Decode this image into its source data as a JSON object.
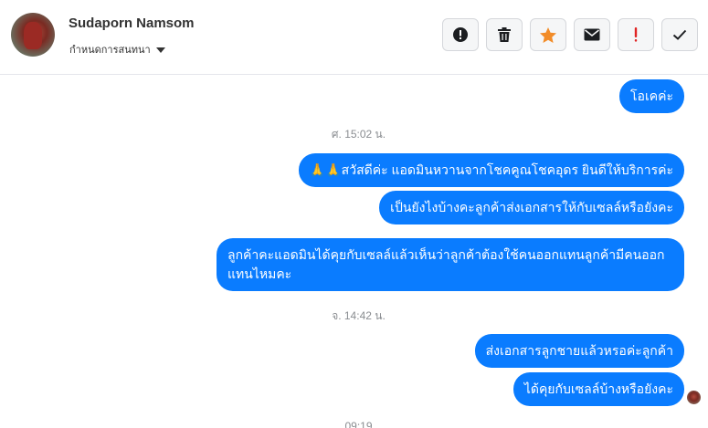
{
  "contact": {
    "name": "Sudaporn Namsom",
    "subtitle": "กำหนดการสนทนา"
  },
  "actions": [
    {
      "icon": "alert-circle-icon"
    },
    {
      "icon": "trash-icon"
    },
    {
      "icon": "star-icon",
      "color": "#f28c28"
    },
    {
      "icon": "envelope-icon"
    },
    {
      "icon": "exclamation-icon",
      "color": "#e02424"
    },
    {
      "icon": "check-icon"
    }
  ],
  "messages": {
    "m0": "โอเคค่ะ",
    "ts1": "ศ. 15:02 น.",
    "m1": "🙏🙏สวัสดีค่ะ แอดมินหวานจากโชคคูณโชคอุดร ยินดีให้บริการค่ะ",
    "m2": "เป็นยังไงบ้างคะลูกค้าส่งเอกสารให้กับเซลล์หรือยังคะ",
    "m3": "ลูกค้าคะแอดมินได้คุยกับเซลล์แล้วเห็นว่าลูกค้าต้องใช้คนออกแทนลูกค้ามีคนออกแทนไหมคะ",
    "ts2": "จ. 14:42 น.",
    "m4": "ส่งเอกสารลูกชายแล้วหรอค่ะลูกค้า",
    "m5": "ได้คุยกับเซลล์บ้างหรือยังคะ",
    "ts3": "09:19"
  },
  "colors": {
    "bubble": "#0a7cff",
    "timestamp": "#8a8d91"
  }
}
